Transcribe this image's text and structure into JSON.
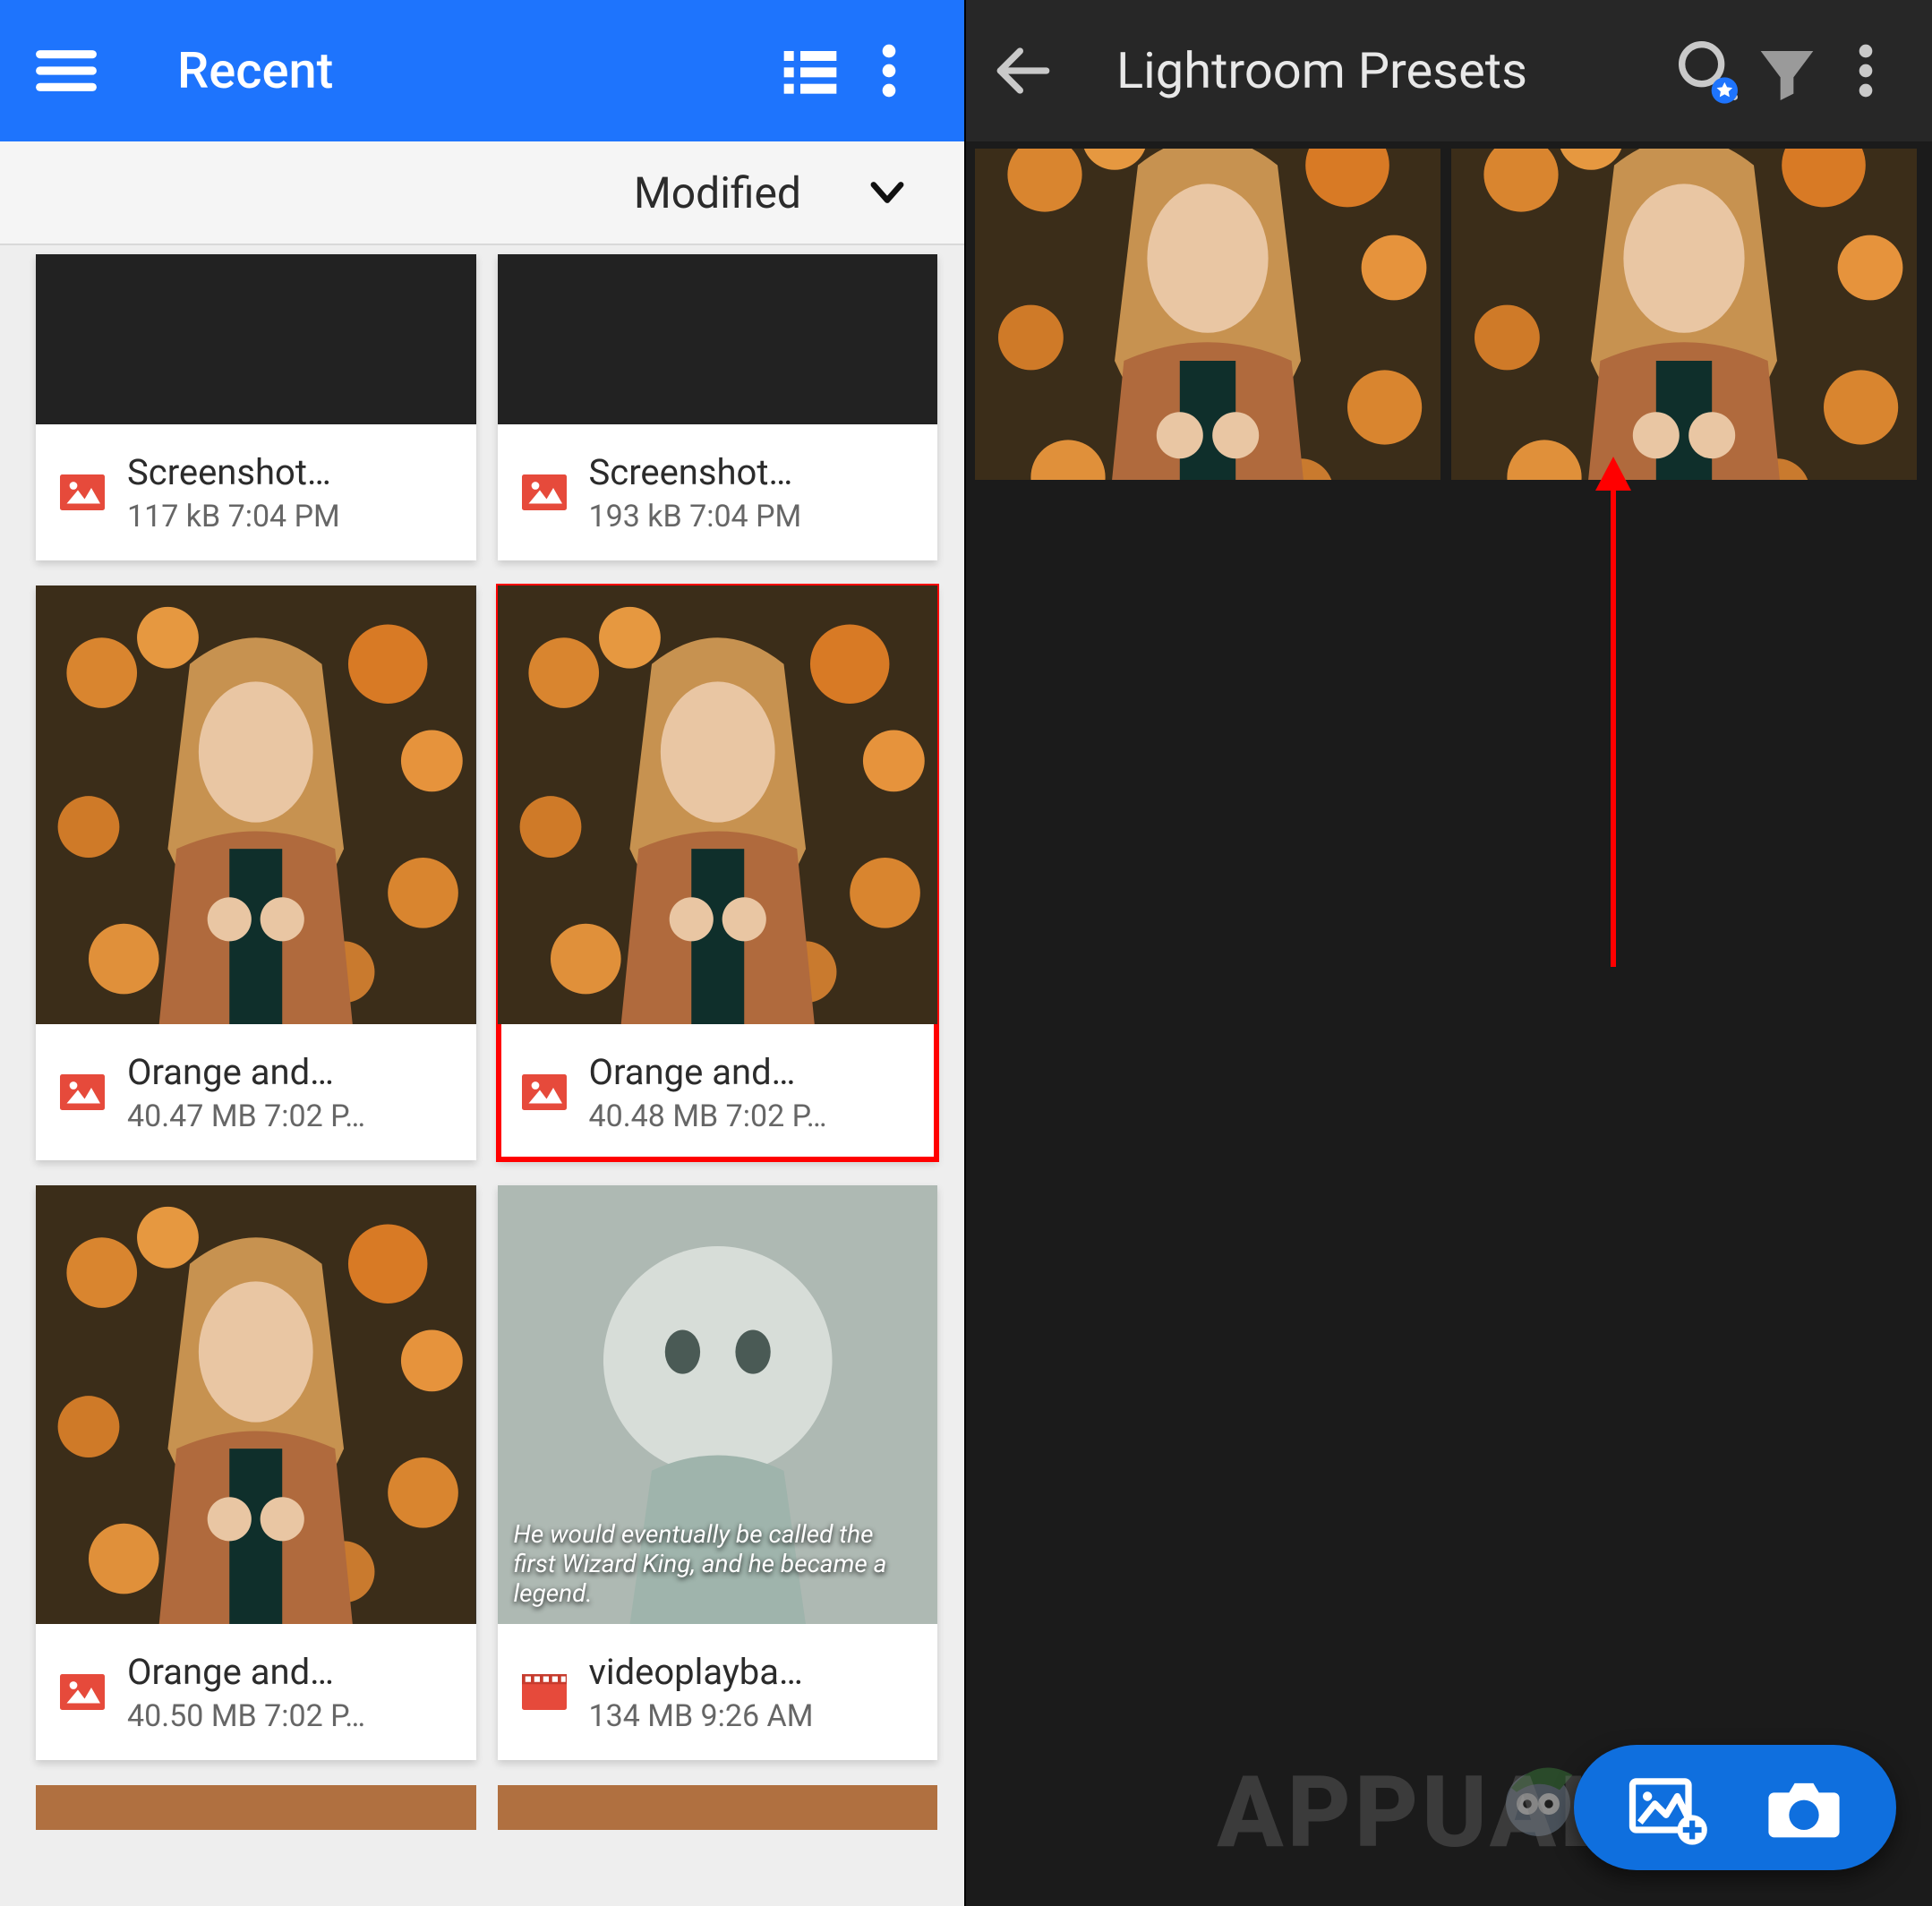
{
  "left": {
    "title": "Recent",
    "sort_label": "Modified",
    "files": [
      {
        "name": "Screenshot…",
        "size": "117 kB",
        "time": "7:04 PM",
        "thumb": "dark",
        "type": "image",
        "highlighted": false
      },
      {
        "name": "Screenshot…",
        "size": "193 kB",
        "time": "7:04 PM",
        "thumb": "dark",
        "type": "image",
        "highlighted": false
      },
      {
        "name": "Orange and…",
        "size": "40.47 MB",
        "time": "7:02 P…",
        "thumb": "girl",
        "type": "image",
        "highlighted": false
      },
      {
        "name": "Orange and…",
        "size": "40.48 MB",
        "time": "7:02 P…",
        "thumb": "girl",
        "type": "image",
        "highlighted": true
      },
      {
        "name": "Orange and…",
        "size": "40.50 MB",
        "time": "7:02 P…",
        "thumb": "girl",
        "type": "image",
        "highlighted": false
      },
      {
        "name": "videoplayba…",
        "size": "134 MB",
        "time": "9:26 AM",
        "thumb": "wizard",
        "type": "video",
        "highlighted": false
      }
    ],
    "wizard_caption": "He would eventually be called the first Wizard King, and he became a legend."
  },
  "right": {
    "title": "Lightroom Presets",
    "thumbs": [
      "girl",
      "girl"
    ]
  },
  "watermark": "APPUALS"
}
